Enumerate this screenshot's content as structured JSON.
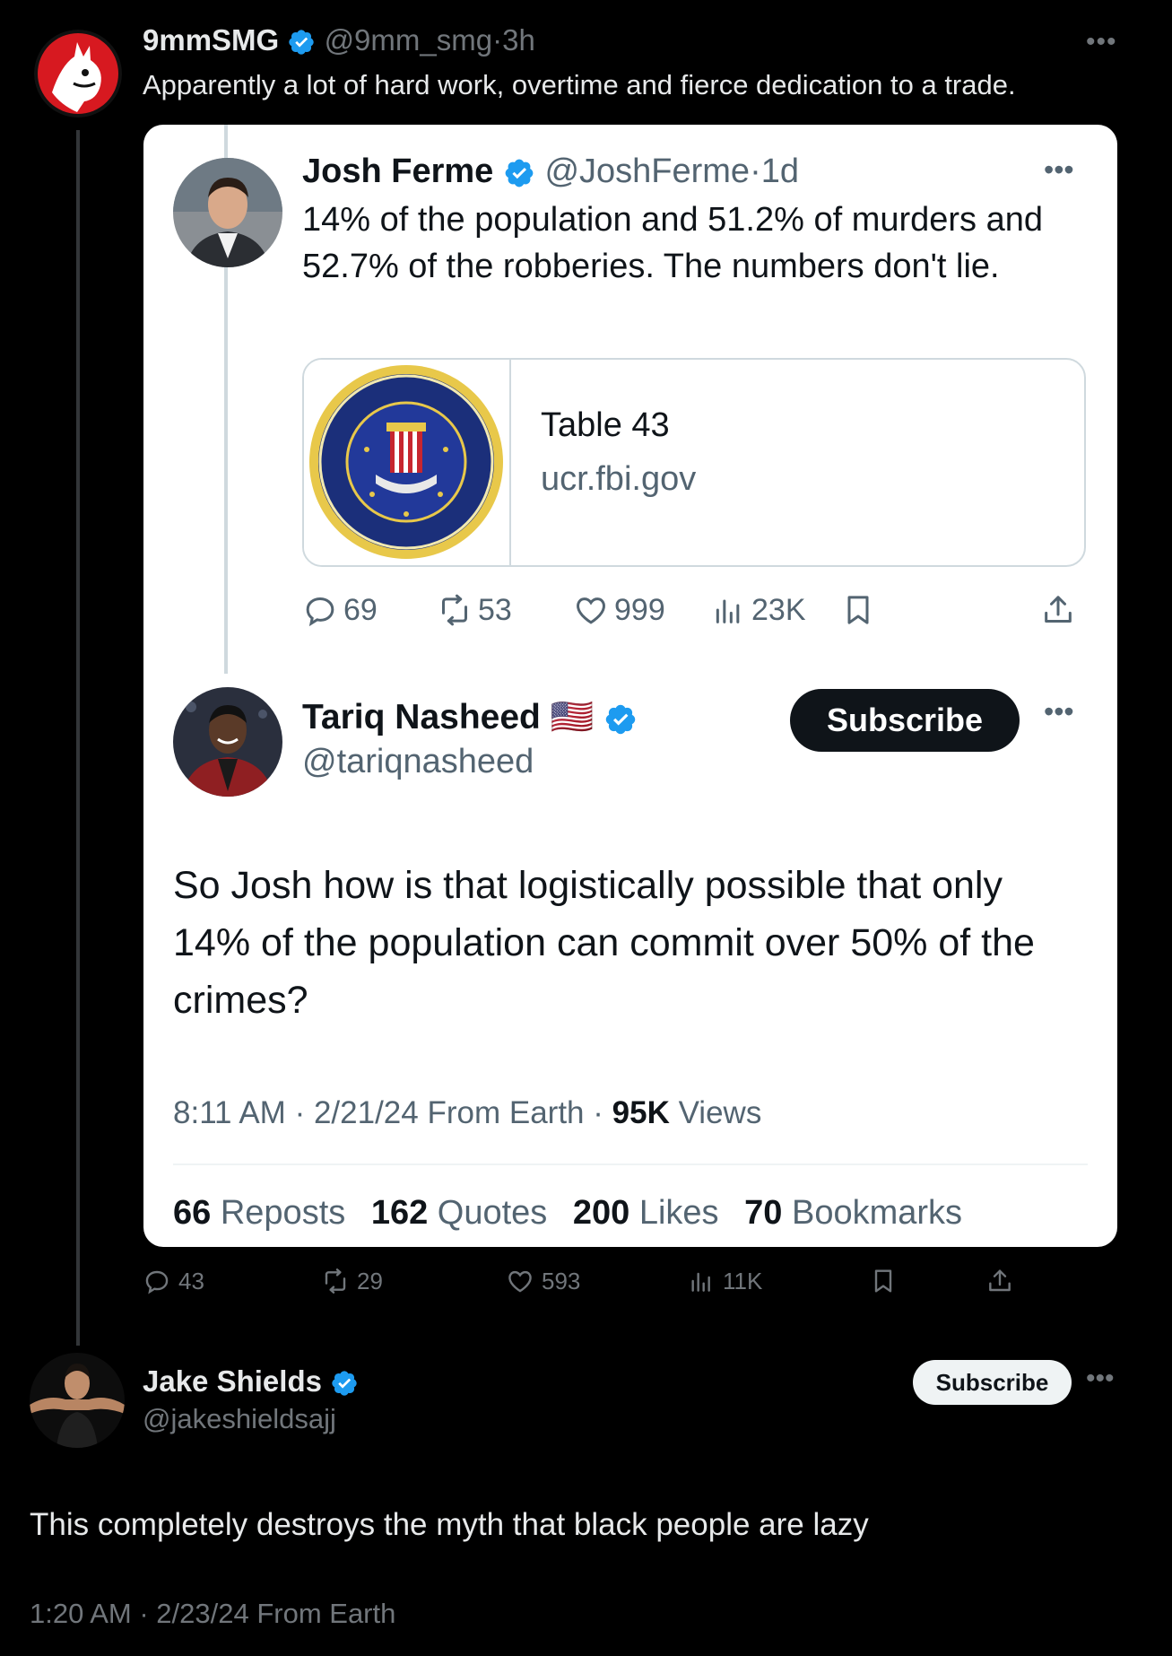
{
  "outer_tweet": {
    "name": "9mmSMG",
    "handle": "@9mm_smg",
    "time": "3h",
    "text": "Apparently a lot of hard work, overtime and fierce dedication to a trade.",
    "actions": {
      "replies": "43",
      "reposts": "29",
      "likes": "593",
      "views": "11K"
    }
  },
  "quoted_tweet": {
    "name": "Josh Ferme",
    "handle": "@JoshFerme",
    "time": "1d",
    "text": "14% of the population and 51.2% of murders and 52.7% of the robberies. The numbers don't lie.",
    "link_card": {
      "title": "Table 43",
      "domain": "ucr.fbi.gov"
    },
    "actions": {
      "replies": "69",
      "reposts": "53",
      "likes": "999",
      "views": "23K"
    }
  },
  "reply_tweet": {
    "name": "Tariq Nasheed",
    "flag": "🇺🇸",
    "handle": "@tariqnasheed",
    "subscribe_label": "Subscribe",
    "text": "So Josh how is that logistically possible that only 14% of the population can commit over 50% of the crimes?",
    "meta": {
      "time": "8:11 AM",
      "date": "2/21/24",
      "source": "From Earth",
      "views_count": "95K",
      "views_label": "Views"
    },
    "stats": [
      {
        "count": "66",
        "label": "Reposts"
      },
      {
        "count": "162",
        "label": "Quotes"
      },
      {
        "count": "200",
        "label": "Likes"
      },
      {
        "count": "70",
        "label": "Bookmarks"
      }
    ]
  },
  "bottom_tweet": {
    "name": "Jake Shields",
    "handle": "@jakeshieldsajj",
    "subscribe_label": "Subscribe",
    "text": "This completely destroys the myth that black people are lazy",
    "meta": "1:20 AM · 2/23/24 From Earth"
  },
  "separator": "·",
  "more_glyph": "•••",
  "colors": {
    "verified": "#1d9bf0",
    "background": "#000000",
    "card": "#ffffff",
    "muted_dark": "#71767b",
    "muted_light": "#536471"
  }
}
